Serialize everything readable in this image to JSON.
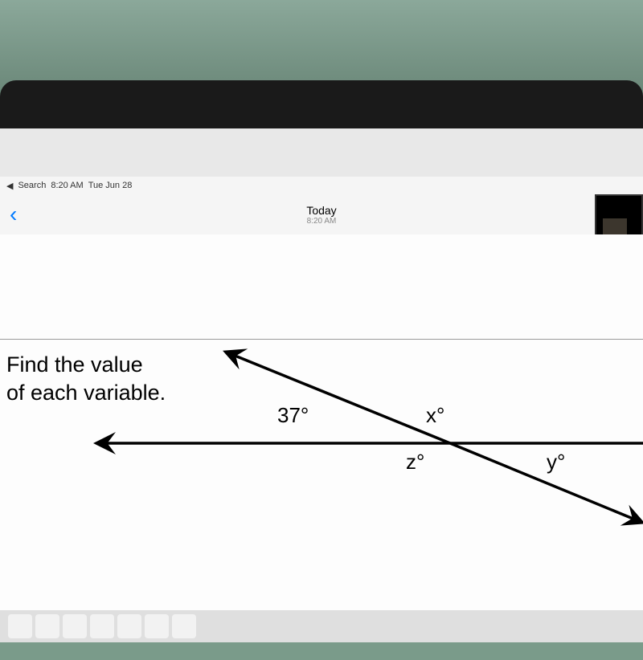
{
  "status_bar": {
    "back_label": "Search",
    "time": "8:20 AM",
    "date": "Tue Jun 28"
  },
  "nav": {
    "title": "Today",
    "subtitle": "8:20 AM"
  },
  "problem": {
    "line1": "Find the value",
    "line2": "of each variable."
  },
  "angles": {
    "given": "37°",
    "x": "x°",
    "z": "z°",
    "y": "y°"
  }
}
